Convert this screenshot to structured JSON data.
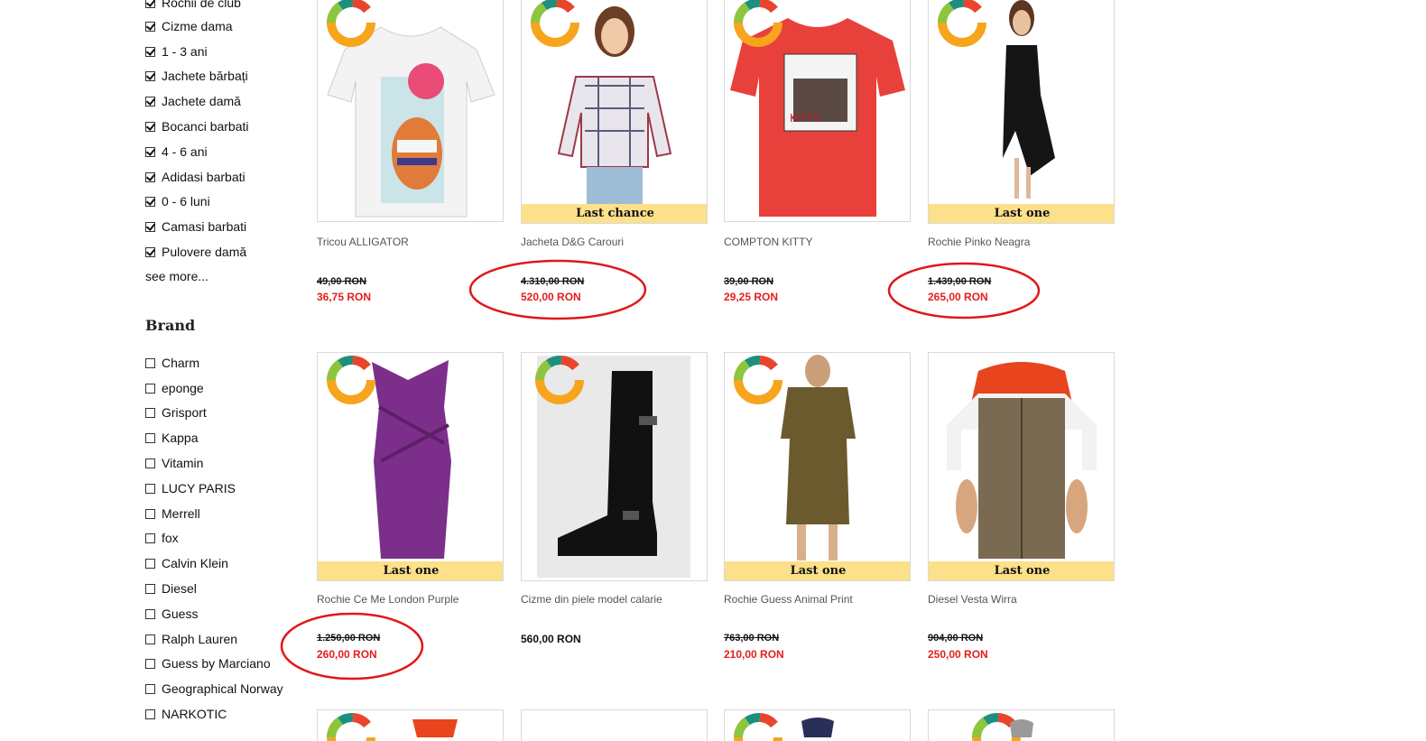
{
  "filters": {
    "checked_items": [
      "Rochii de club",
      "Cizme dama",
      "1 - 3 ani",
      "Jachete bărbați",
      "Jachete damă",
      "Bocanci barbati",
      "4 - 6 ani",
      "Adidasi barbati",
      "0 - 6 luni",
      "Camasi barbati",
      "Pulovere damă"
    ],
    "see_more_label": "see more..."
  },
  "brand": {
    "heading": "Brand",
    "items": [
      "Charm",
      "eponge",
      "Grisport",
      "Kappa",
      "Vitamin",
      "LUCY PARIS",
      "Merrell",
      "fox",
      "Calvin Klein",
      "Diesel",
      "Guess",
      "Ralph Lauren",
      "Guess by Marciano",
      "Geographical Norway",
      "NARKOTIC"
    ]
  },
  "products": [
    {
      "name": "Tricou ALLIGATOR",
      "old_price": "49,00 RON",
      "price": "36,75 RON",
      "badge": "",
      "image_icon": "white-tshirt-alligator-icon"
    },
    {
      "name": "Jacheta D&G Carouri",
      "old_price": "4.310,00 RON",
      "price": "520,00 RON",
      "badge": "Last chance",
      "image_icon": "plaid-jacket-woman-icon"
    },
    {
      "name": "COMPTON KITTY",
      "old_price": "39,00 RON",
      "price": "29,25 RON",
      "badge": "",
      "image_icon": "red-tshirt-icon"
    },
    {
      "name": "Rochie Pinko Neagra",
      "old_price": "1.439,00 RON",
      "price": "265,00 RON",
      "badge": "Last one",
      "image_icon": "black-dress-icon"
    },
    {
      "name": "Rochie Ce Me London Purple",
      "old_price": "1.250,00 RON",
      "price": "260,00 RON",
      "badge": "Last one",
      "image_icon": "purple-dress-icon"
    },
    {
      "name": "Cizme din piele model calarie",
      "old_price": "",
      "price": "560,00 RON",
      "badge": "",
      "image_icon": "black-boot-icon"
    },
    {
      "name": "Rochie Guess Animal Print",
      "old_price": "763,00 RON",
      "price": "210,00 RON",
      "badge": "Last one",
      "image_icon": "animal-print-dress-icon"
    },
    {
      "name": "Diesel Vesta Wirra",
      "old_price": "904,00 RON",
      "price": "250,00 RON",
      "badge": "Last one",
      "image_icon": "brown-vest-man-icon"
    }
  ],
  "colors": {
    "badge_bg": "#fde08a",
    "sale_price": "#e41e1e",
    "annotation_circle": "#e01818",
    "logo_orange": "#f6a51d",
    "logo_red": "#e8452c",
    "logo_teal": "#1e8f7d",
    "logo_green": "#8cc63f"
  }
}
